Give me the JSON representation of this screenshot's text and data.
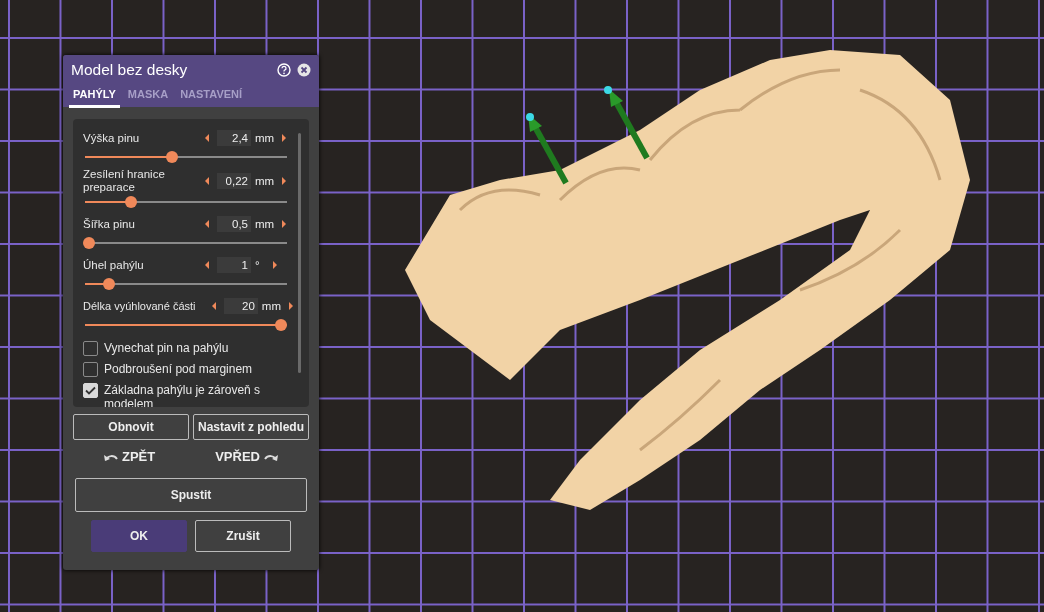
{
  "dialog": {
    "title": "Model bez desky",
    "tabs": [
      {
        "label": "PAHÝLY",
        "selected": true
      },
      {
        "label": "MASKA",
        "selected": false
      },
      {
        "label": "NASTAVENÍ",
        "selected": false
      }
    ],
    "parameters": [
      {
        "label": "Výška pinu",
        "value": "2,4",
        "unit": "mm",
        "level": 0.43
      },
      {
        "label": "Zesílení hranice preparace",
        "value": "0,22",
        "unit": "mm",
        "level": 0.23
      },
      {
        "label": "Šířka pinu",
        "value": "0,5",
        "unit": "mm",
        "level": 0.02
      },
      {
        "label": "Úhel pahýlu",
        "value": "1",
        "unit": "°",
        "level": 0.12
      },
      {
        "label": "Délka vyúhlované části",
        "value": "20",
        "unit": "mm",
        "level": 0.97
      }
    ],
    "options": [
      {
        "label": "Vynechat pin na pahýlu",
        "checked": false
      },
      {
        "label": "Podbroušení pod marginem",
        "checked": false
      },
      {
        "label": "Základna pahýlu je zároveň s modelem",
        "checked": true
      }
    ],
    "reset_button": "Obnovit",
    "view_button": "Nastavit z pohledu",
    "undo": "ZPĚT",
    "redo": "VPŘED",
    "run_button": "Spustit",
    "ok_button": "OK",
    "cancel_button": "Zrušit"
  }
}
